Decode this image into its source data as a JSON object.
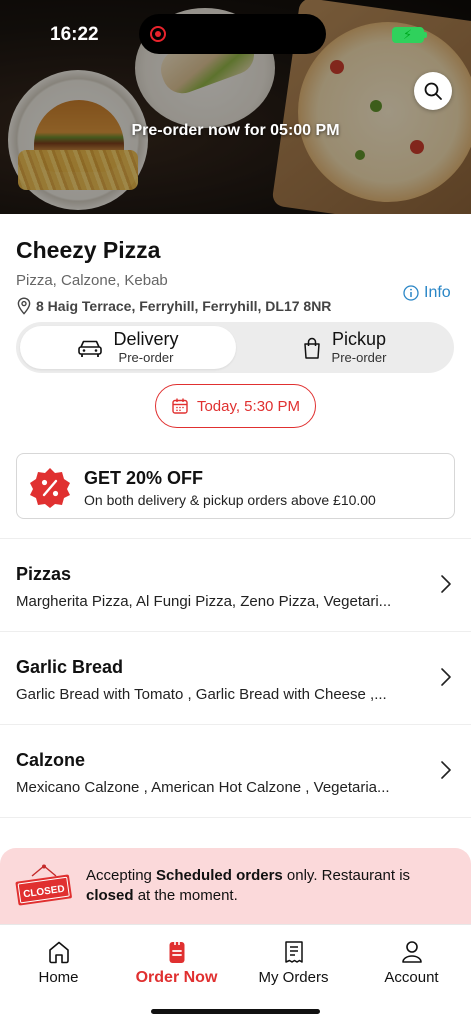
{
  "status": {
    "time": "16:22"
  },
  "hero": {
    "banner": "Pre-order now for 05:00 PM"
  },
  "restaurant": {
    "name": "Cheezy Pizza",
    "cuisines": "Pizza, Calzone, Kebab",
    "address": "8 Haig Terrace, Ferryhill, Ferryhill, DL17 8NR",
    "info_label": "Info"
  },
  "order_type": {
    "delivery": {
      "label": "Delivery",
      "sub": "Pre-order",
      "selected": true
    },
    "pickup": {
      "label": "Pickup",
      "sub": "Pre-order",
      "selected": false
    }
  },
  "schedule": {
    "label": "Today, 5:30 PM"
  },
  "offer": {
    "title": "GET 20% OFF",
    "subtitle": "On both delivery & pickup orders above £10.00"
  },
  "categories": [
    {
      "title": "Pizzas",
      "items": "Margherita Pizza, Al Fungi Pizza, Zeno Pizza, Vegetari..."
    },
    {
      "title": "Garlic Bread",
      "items": "Garlic Bread with Tomato , Garlic Bread with Cheese ,..."
    },
    {
      "title": "Calzone",
      "items": "Mexicano Calzone , American Hot Calzone , Vegetaria..."
    }
  ],
  "closed_notice": {
    "sign_text": "CLOSED",
    "part1": "Accepting ",
    "bold1": "Scheduled orders",
    "part2": " only. Restaurant is ",
    "bold2": "closed",
    "part3": " at the moment."
  },
  "tabbar": {
    "home": "Home",
    "order_now": "Order Now",
    "my_orders": "My Orders",
    "account": "Account",
    "active": "order_now"
  },
  "colors": {
    "accent": "#e03030",
    "info": "#2a86c6",
    "banner_bg": "#fbd9da"
  }
}
